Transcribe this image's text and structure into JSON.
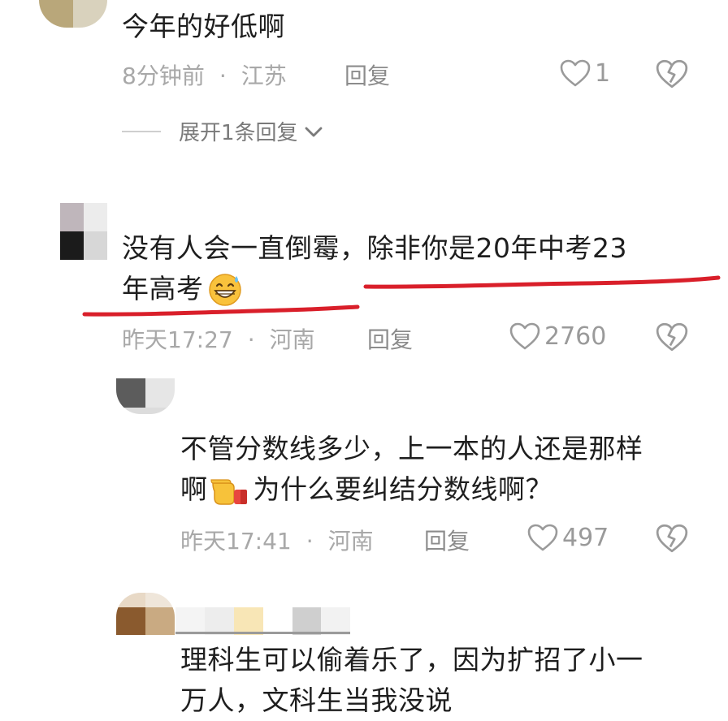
{
  "colors": {
    "meta_text": "#a8a8a8",
    "comment_text": "#1e1e1e",
    "underline": "#d91f2a"
  },
  "comments": [
    {
      "text": "今年的好低啊",
      "time": "8分钟前",
      "location": "江苏",
      "reply_label": "回复",
      "likes": "1",
      "expand_label": "展开1条回复"
    },
    {
      "text_line1": "没有人会一直倒霉，除非你是20年中考23",
      "text_line2": "年高考",
      "emoji": "grinning-sweat-emoji",
      "time": "昨天17:27",
      "location": "河南",
      "reply_label": "回复",
      "likes": "2760"
    },
    {
      "text_line1": "不管分数线多少，上一本的人还是那样",
      "text_line2_a": "啊",
      "emoji": "pointing-hand-emoji",
      "text_line2_b": "为什么要纠结分数线啊？",
      "time": "昨天17:41",
      "location": "河南",
      "reply_label": "回复",
      "likes": "497"
    },
    {
      "text_line1": "理科生可以偷着乐了，因为扩招了小一",
      "text_line2": "万人，文科生当我没说"
    }
  ]
}
